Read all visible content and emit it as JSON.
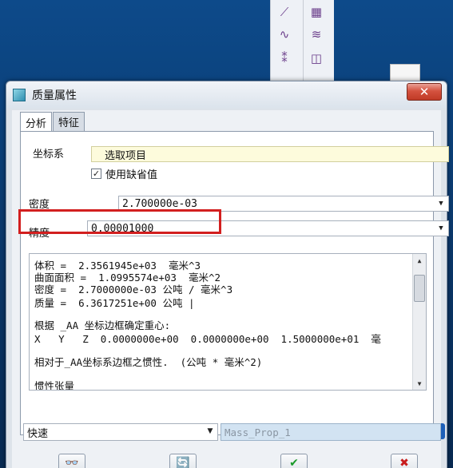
{
  "window": {
    "title": "质量属性",
    "close_glyph": "✕"
  },
  "tabs": [
    {
      "label": "分析",
      "active": true
    },
    {
      "label": "特征",
      "active": false
    }
  ],
  "coord_system": {
    "label": "坐标系",
    "value": "选取项目",
    "use_default_label": "使用缺省值",
    "use_default_checked": true
  },
  "density": {
    "label": "密度",
    "value": "2.700000e-03"
  },
  "accuracy": {
    "label": "精度",
    "value": "0.00001000"
  },
  "results": {
    "lines": [
      "体积 =  2.3561945e+03  毫米^3",
      "曲面面积 =  1.0995574e+03  毫米^2",
      "密度 =  2.7000000e-03 公吨 / 毫米^3",
      "质量 =  6.3617251e+00 公吨 |",
      "",
      "根据 _AA 坐标边框确定重心:",
      "X   Y   Z  0.0000000e+00  0.0000000e+00  1.5000000e+01  毫",
      "",
      "相对于_AA坐标系边框之惯性.  (公吨 * 毫米^2)",
      "",
      "惯性张量"
    ]
  },
  "mode": {
    "value": "快速"
  },
  "feature_name": {
    "value": "Mass_Prop_1"
  },
  "colors": {
    "highlight": "#d21f1f",
    "name_field_bg": "#d2e3f2",
    "coord_field_bg": "#fdfbdc"
  },
  "icons": {
    "info": "i",
    "preview": "👓",
    "repeat": "🔄",
    "ok": "✔",
    "cancel": "✖"
  }
}
